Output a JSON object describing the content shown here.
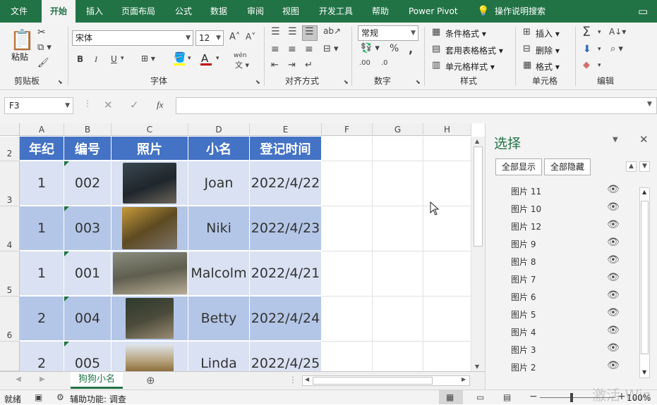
{
  "tabs": [
    "文件",
    "开始",
    "插入",
    "页面布局",
    "公式",
    "数据",
    "审阅",
    "视图",
    "开发工具",
    "帮助",
    "Power Pivot",
    "操作说明搜索"
  ],
  "ribbon": {
    "clipboard": {
      "paste": "粘贴",
      "label": "剪贴板"
    },
    "font": {
      "name": "宋体",
      "size": "12",
      "label": "字体",
      "bold": "B",
      "italic": "I",
      "underline": "U",
      "phonetic": "wén"
    },
    "alignment": {
      "label": "对齐方式"
    },
    "number": {
      "format": "常规",
      "label": "数字",
      "percent": "%",
      "comma": ","
    },
    "styles": {
      "conditional": "条件格式",
      "table": "套用表格格式",
      "cell": "单元格样式",
      "label": "样式"
    },
    "cells": {
      "insert": "插入",
      "delete": "删除",
      "format": "格式",
      "label": "单元格"
    },
    "editing": {
      "label": "编辑"
    }
  },
  "formula_bar": {
    "name_box": "F3",
    "fx": "fx",
    "value": ""
  },
  "columns": [
    "A",
    "B",
    "C",
    "D",
    "E",
    "F",
    "G",
    "H"
  ],
  "rows": [
    "2",
    "3",
    "4",
    "5",
    "6"
  ],
  "table": {
    "headers": [
      "年纪",
      "编号",
      "照片",
      "小名",
      "登记时间"
    ],
    "rows": [
      {
        "grade": "1",
        "id": "002",
        "name": "Joan",
        "date": "2022/4/22"
      },
      {
        "grade": "1",
        "id": "003",
        "name": "Niki",
        "date": "2022/4/23"
      },
      {
        "grade": "1",
        "id": "001",
        "name": "Malcolm",
        "date": "2022/4/21"
      },
      {
        "grade": "2",
        "id": "004",
        "name": "Betty",
        "date": "2022/4/24"
      },
      {
        "grade": "2",
        "id": "005",
        "name": "Linda",
        "date": "2022/4/25"
      }
    ]
  },
  "sheet_tab": "狗狗小名",
  "status": {
    "ready": "就绪",
    "accessibility": "辅助功能: 调查",
    "zoom": "100%"
  },
  "watermark": "激活 Win",
  "selection_pane": {
    "title": "选择",
    "show_all": "全部显示",
    "hide_all": "全部隐藏",
    "items": [
      "图片 11",
      "图片 10",
      "图片 12",
      "图片 9",
      "图片 8",
      "图片 7",
      "图片 6",
      "图片 5",
      "图片 4",
      "图片 3",
      "图片 2"
    ]
  },
  "colors": {
    "accent": "#217346",
    "header_fill": "#4472c4",
    "light_fill": "#d9e1f2",
    "dark_fill": "#b4c6e7"
  }
}
